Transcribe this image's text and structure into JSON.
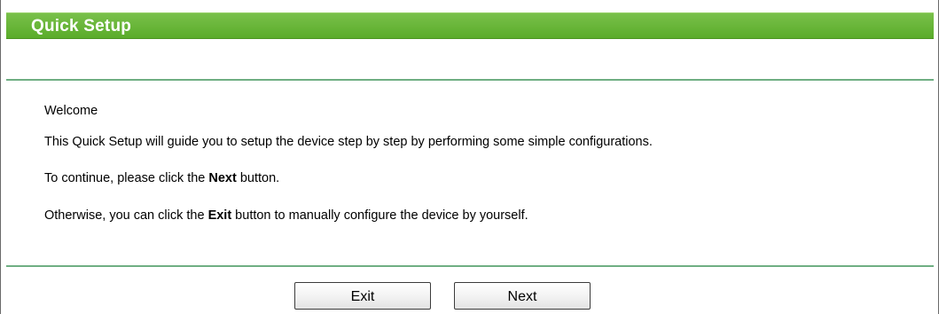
{
  "header": {
    "title": "Quick Setup"
  },
  "welcome": {
    "heading": "Welcome",
    "line1": "This Quick Setup will guide you to setup the device step by step by performing some simple configurations.",
    "line2": {
      "before": "To continue, please click the ",
      "bold": "Next",
      "after": " button."
    },
    "line3": {
      "before": "Otherwise, you can click the ",
      "bold": "Exit",
      "after": " button to manually configure the device by yourself."
    }
  },
  "buttons": {
    "exit_label": "Exit",
    "next_label": "Next"
  },
  "colors": {
    "title_bar": "#63b233",
    "divider": "#6fae83",
    "title_text": "#ffffff"
  }
}
